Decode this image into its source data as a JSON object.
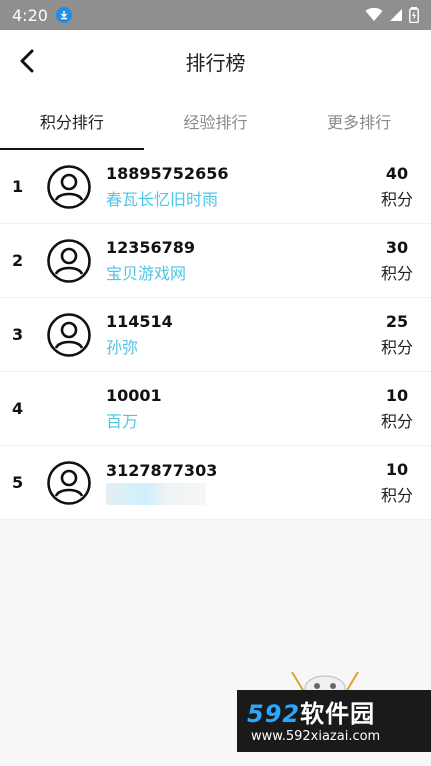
{
  "status": {
    "time": "4:20"
  },
  "header": {
    "title": "排行榜"
  },
  "tabs": [
    {
      "label": "积分排行",
      "active": true
    },
    {
      "label": "经验排行",
      "active": false
    },
    {
      "label": "更多排行",
      "active": false
    }
  ],
  "rows": [
    {
      "rank": "1",
      "uid": "18895752656",
      "name": "春瓦长忆旧时雨",
      "score": "40",
      "unit": "积分"
    },
    {
      "rank": "2",
      "uid": "12356789",
      "name": "宝贝游戏网",
      "score": "30",
      "unit": "积分"
    },
    {
      "rank": "3",
      "uid": "114514",
      "name": "孙弥",
      "score": "25",
      "unit": "积分"
    },
    {
      "rank": "4",
      "uid": "10001",
      "name": "百万",
      "score": "10",
      "unit": "积分"
    },
    {
      "rank": "5",
      "uid": "3127877303",
      "name": "",
      "score": "10",
      "unit": "积分"
    }
  ],
  "watermark": {
    "brand_num": "592",
    "brand_text": "软件园",
    "url": "www.592xiazai.com"
  },
  "colors": {
    "accent": "#4cc6e6",
    "statusbar": "#8f8f8f"
  }
}
